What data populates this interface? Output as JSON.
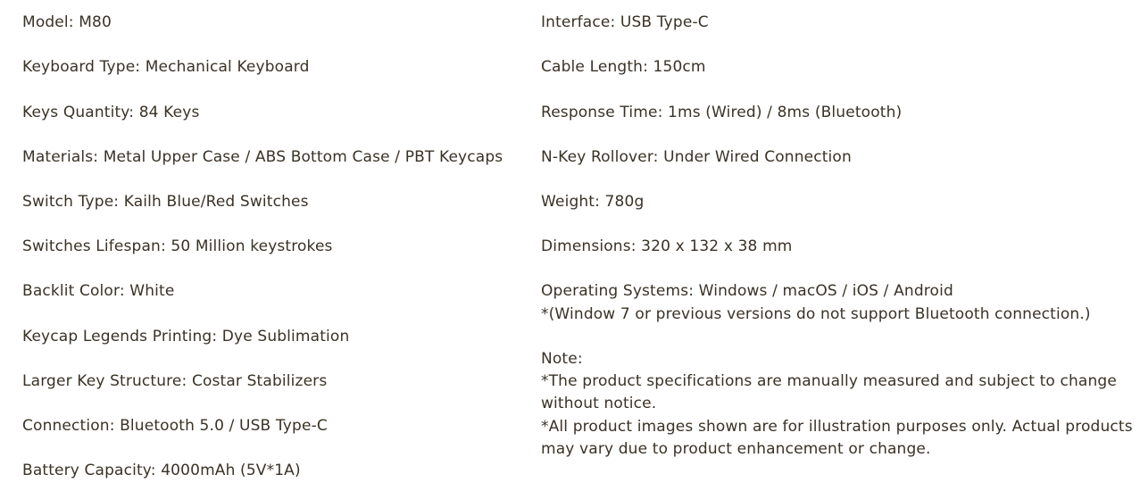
{
  "left_specs": [
    "Model: M80",
    "Keyboard Type: Mechanical Keyboard",
    "Keys Quantity: 84 Keys",
    "Materials: Metal Upper Case / ABS Bottom Case / PBT Keycaps",
    "Switch Type: Kailh Blue/Red Switches",
    "Switches Lifespan: 50 Million keystrokes",
    "Backlit Color: White",
    "Keycap Legends Printing: Dye Sublimation",
    "Larger Key Structure: Costar Stabilizers",
    "Connection: Bluetooth 5.0 / USB Type-C",
    "Battery Capacity: 4000mAh (5V*1A)"
  ],
  "right_specs": [
    "Interface: USB Type-C",
    "Cable Length: 150cm",
    "Response Time: 1ms (Wired) / 8ms (Bluetooth)",
    "N-Key Rollover: Under Wired Connection",
    "Weight: 780g",
    "Dimensions: 320 x 132 x 38 mm",
    "Operating Systems: Windows / macOS / iOS / Android"
  ],
  "os_footnote": "*(Window 7 or previous versions do not support Bluetooth connection.)",
  "note": {
    "heading": "Note:",
    "lines": [
      "*The product specifications are manually measured and subject to change",
      "without notice.",
      "*All product images shown are for illustration purposes only. Actual products",
      "may vary due to product enhancement or change."
    ]
  }
}
